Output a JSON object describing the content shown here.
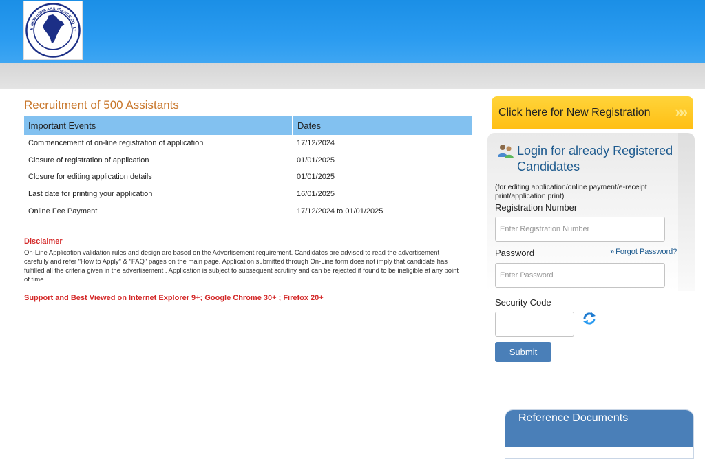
{
  "header": {
    "logo_icon": "new-india-assurance-logo",
    "logo_text": "THE NEW INDIA ASSURANCE CO. LTD."
  },
  "main": {
    "title": "Recruitment of 500 Assistants",
    "table": {
      "headers": [
        "Important Events",
        "Dates"
      ],
      "rows": [
        [
          "Commencement of on-line registration of application",
          "17/12/2024"
        ],
        [
          "Closure of registration of application",
          "01/01/2025"
        ],
        [
          "Closure for editing application details",
          "01/01/2025"
        ],
        [
          "Last date for printing your application",
          "16/01/2025"
        ],
        [
          "Online Fee Payment",
          "17/12/2024 to 01/01/2025"
        ]
      ]
    },
    "disclaimer_title": "Disclaimer",
    "disclaimer_text": "On-Line Application validation rules and design are based on the Advertisement requirement. Candidates are advised to read the advertisement carefully and refer \"How to Apply\" & \"FAQ\" pages on the main page. Application submitted through On-Line form does not imply that candidate has fulfilled all the criteria given in the advertisement . Application is subject to subsequent scrutiny and can be rejected if found to be ineligible at any point of time.",
    "browser_note": "Support and Best Viewed on Internet Explorer 9+; Google Chrome 30+ ; Firefox 20+"
  },
  "sidebar": {
    "new_registration_label": "Click here for New Registration",
    "new_registration_arrows": "»»",
    "login": {
      "icon": "users-icon",
      "title": "Login for already Registered Candidates",
      "note": "(for editing application/online payment/e-receipt print/application print)",
      "registration_label": "Registration Number",
      "registration_placeholder": "Enter Registration Number",
      "password_label": "Password",
      "password_placeholder": "Enter Password",
      "forgot_password": "Forgot Password?",
      "forgot_arrows": "»",
      "security_code_label": "Security Code",
      "security_code_value": "",
      "submit_label": "Submit"
    },
    "reference_documents_title": "Reference Documents"
  },
  "colors": {
    "header_blue": "#2a9bf0",
    "accent_orange": "#c8762a",
    "disclaimer_red": "#d42a2a",
    "registration_yellow": "#ffc61f",
    "button_blue": "#4a7fb8",
    "table_header_blue": "#82c1f0"
  }
}
